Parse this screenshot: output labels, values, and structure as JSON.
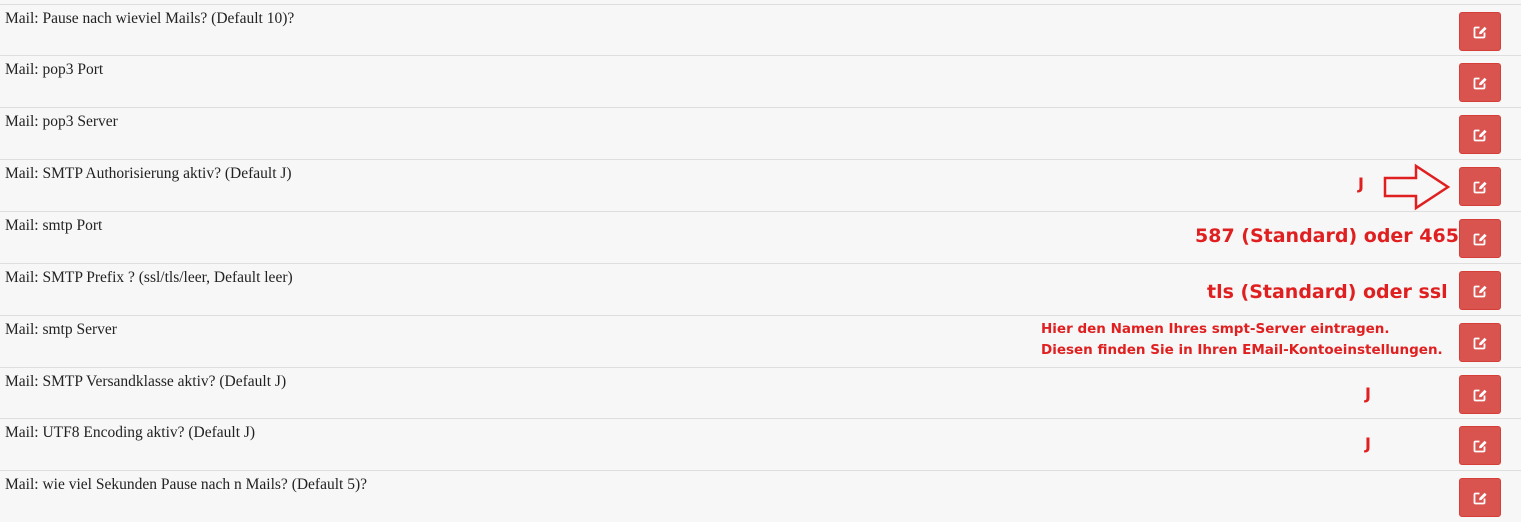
{
  "rows": [
    {
      "label": "Mail: Pause nach wieviel Mails? (Default 10)?"
    },
    {
      "label": "Mail: pop3 Port"
    },
    {
      "label": "Mail: pop3 Server"
    },
    {
      "label": "Mail: SMTP Authorisierung aktiv? (Default J)"
    },
    {
      "label": "Mail: smtp Port"
    },
    {
      "label": "Mail: SMTP Prefix ? (ssl/tls/leer, Default leer)"
    },
    {
      "label": "Mail: smtp Server"
    },
    {
      "label": "Mail: SMTP Versandklasse aktiv? (Default J)"
    },
    {
      "label": "Mail: UTF8 Encoding aktiv? (Default J)"
    },
    {
      "label": "Mail: wie viel Sekunden Pause nach n Mails? (Default 5)?"
    }
  ],
  "edit_icon": "edit-square-icon",
  "annotations": {
    "smtp_auth": "J",
    "smtp_port": "587 (Standard) oder 465",
    "smtp_prefix": "tls (Standard) oder ssl",
    "smtp_server_line1": "Hier den Namen Ihres smpt-Server eintragen.",
    "smtp_server_line2": "Diesen finden Sie in Ihren EMail-Kontoeinstellungen.",
    "smtp_versandklasse": "J",
    "utf8": "J"
  },
  "colors": {
    "button": "#d9534f",
    "annotation": "#e02020",
    "background": "#f7f7f7"
  }
}
